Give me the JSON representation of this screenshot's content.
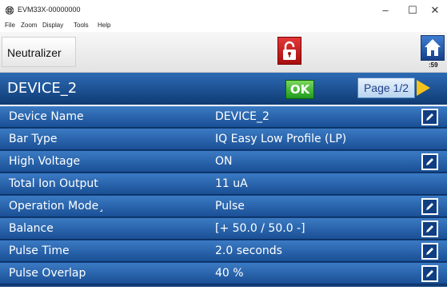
{
  "window": {
    "title": "EVM33X-00000000",
    "minimize": "–",
    "maximize": "☐",
    "close": "✕",
    "icon": "app-globe-icon"
  },
  "menu": [
    "File",
    "Zoom",
    "Display",
    "Tools",
    "Help"
  ],
  "topbar": {
    "neutralizer_label": "Neutralizer",
    "lock_icon": "lock-icon",
    "home_icon": "home-icon",
    "timer": ":59"
  },
  "header": {
    "device_title": "DEVICE_2",
    "ok_label": "OK",
    "page_label": "Page 1/2",
    "next_icon": "next-page-arrow-icon"
  },
  "rows": [
    {
      "label": "Device Name",
      "value": "DEVICE_2",
      "editable": true
    },
    {
      "label": "Bar Type",
      "value": "IQ Easy Low Profile (LP)",
      "editable": false
    },
    {
      "label": "High Voltage",
      "value": "ON",
      "editable": true
    },
    {
      "label": "Total Ion Output",
      "value": "11  uA",
      "editable": false
    },
    {
      "label": "Operation Mode¸",
      "value": "Pulse",
      "editable": true
    },
    {
      "label": "Balance",
      "value": "[+ 50.0 / 50.0 -]",
      "editable": true
    },
    {
      "label": "Pulse Time",
      "value": "2.0  seconds",
      "editable": true
    },
    {
      "label": "Pulse Overlap",
      "value": "40 %",
      "editable": true
    }
  ],
  "colors": {
    "header_blue": "#1f5599",
    "row_blue": "#2b64ad",
    "lock_red": "#c51d1d",
    "ok_green": "#3cb83a",
    "arrow_yellow": "#f4c21a"
  }
}
